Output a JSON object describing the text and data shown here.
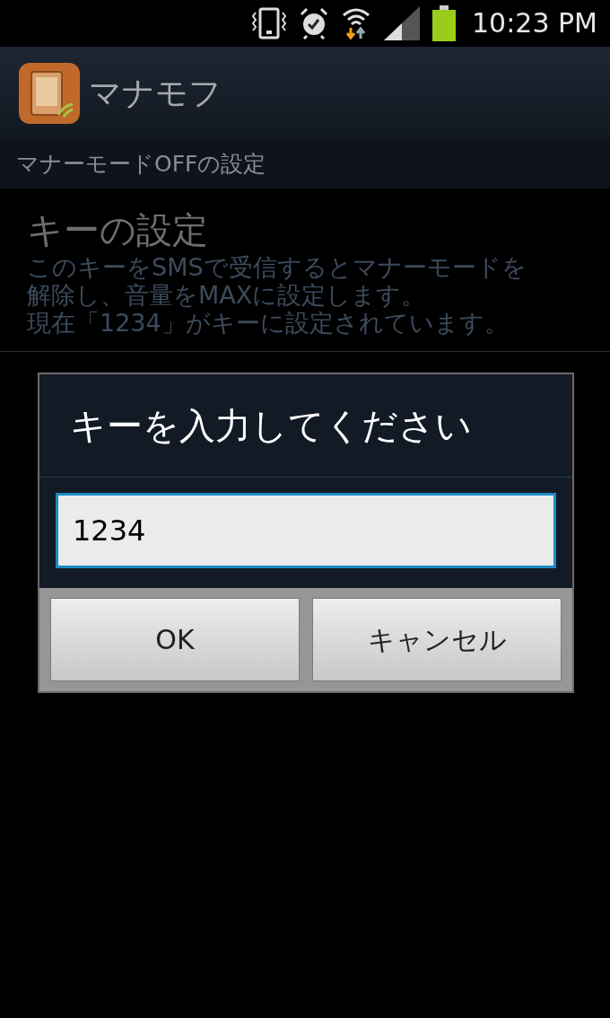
{
  "status_bar": {
    "time": "10:23 PM"
  },
  "action_bar": {
    "title": "マナモフ"
  },
  "section_header": "マナーモードOFFの設定",
  "preferences": [
    {
      "title": "キーの設定",
      "summary": [
        "このキーをSMSで受信するとマナーモードを解除し、音量をMAXに設定します。",
        "現在「1234」がキーに設定されています。"
      ]
    }
  ],
  "dialog": {
    "title": "キーを入力してください",
    "value": "1234",
    "buttons": [
      "OK",
      "キャンセル"
    ]
  }
}
